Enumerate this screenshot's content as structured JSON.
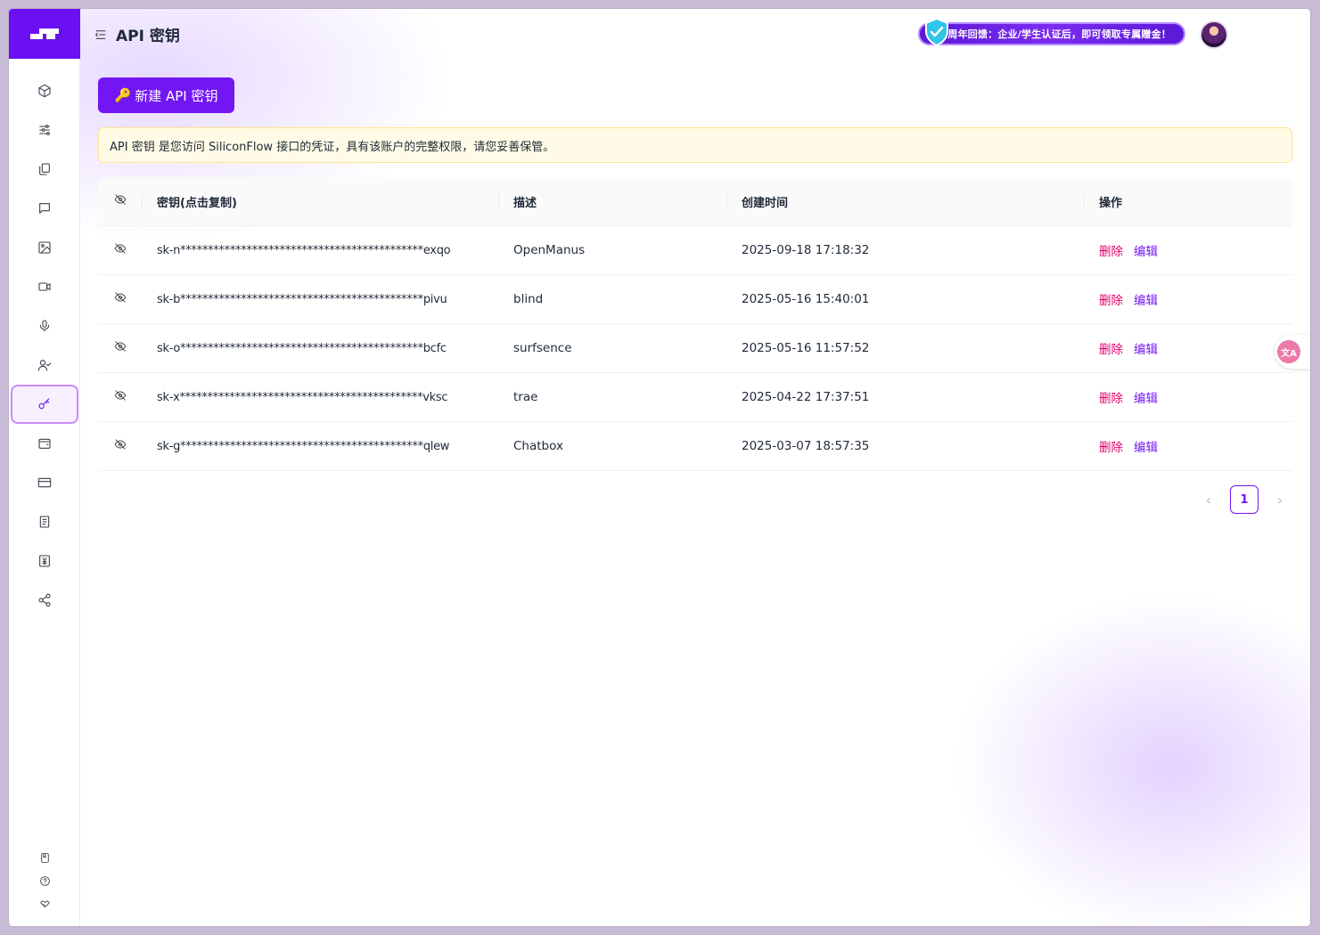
{
  "header": {
    "title": "API 密钥",
    "promo_text": "周年回馈：企业/学生认证后，即可领取专属赠金！"
  },
  "sidebar": {
    "items": [
      {
        "icon": "cube-icon"
      },
      {
        "icon": "sliders-icon"
      },
      {
        "icon": "copy-icon"
      },
      {
        "icon": "chat-icon"
      },
      {
        "icon": "image-icon"
      },
      {
        "icon": "video-icon"
      },
      {
        "icon": "mic-icon"
      },
      {
        "icon": "user-check-icon"
      },
      {
        "icon": "key-icon",
        "active": true
      },
      {
        "icon": "wallet-icon"
      },
      {
        "icon": "card-icon"
      },
      {
        "icon": "document-icon"
      },
      {
        "icon": "yen-icon"
      },
      {
        "icon": "share-icon"
      }
    ],
    "bottom": [
      {
        "icon": "book-icon"
      },
      {
        "icon": "help-icon"
      },
      {
        "icon": "handshake-icon"
      }
    ]
  },
  "actions": {
    "new_key_label": "新建 API 密钥",
    "new_key_emoji": "🔑"
  },
  "notice": {
    "text": "API 密钥 是您访问 SiliconFlow 接口的凭证，具有该账户的完整权限，请您妥善保管。"
  },
  "table": {
    "headers": [
      "密钥(点击复制)",
      "描述",
      "创建时间",
      "操作"
    ],
    "rows": [
      {
        "key": "sk-n********************************************exqo",
        "desc": "OpenManus",
        "created": "2025-09-18 17:18:32",
        "del": "删除",
        "edit": "编辑"
      },
      {
        "key": "sk-b********************************************pivu",
        "desc": "blind",
        "created": "2025-05-16 15:40:01",
        "del": "删除",
        "edit": "编辑"
      },
      {
        "key": "sk-o********************************************bcfc",
        "desc": "surfsence",
        "created": "2025-05-16 11:57:52",
        "del": "删除",
        "edit": "编辑"
      },
      {
        "key": "sk-x********************************************vksc",
        "desc": "trae",
        "created": "2025-04-22 17:37:51",
        "del": "删除",
        "edit": "编辑"
      },
      {
        "key": "sk-g********************************************qlew",
        "desc": "Chatbox",
        "created": "2025-03-07 18:57:35",
        "del": "删除",
        "edit": "编辑"
      }
    ]
  },
  "pagination": {
    "current": "1",
    "prev": "‹",
    "next": "›"
  },
  "translate": {
    "label": "文A"
  },
  "colors": {
    "accent": "#7216f4",
    "danger": "#e0006a",
    "notice_bg": "#fffbe6"
  }
}
